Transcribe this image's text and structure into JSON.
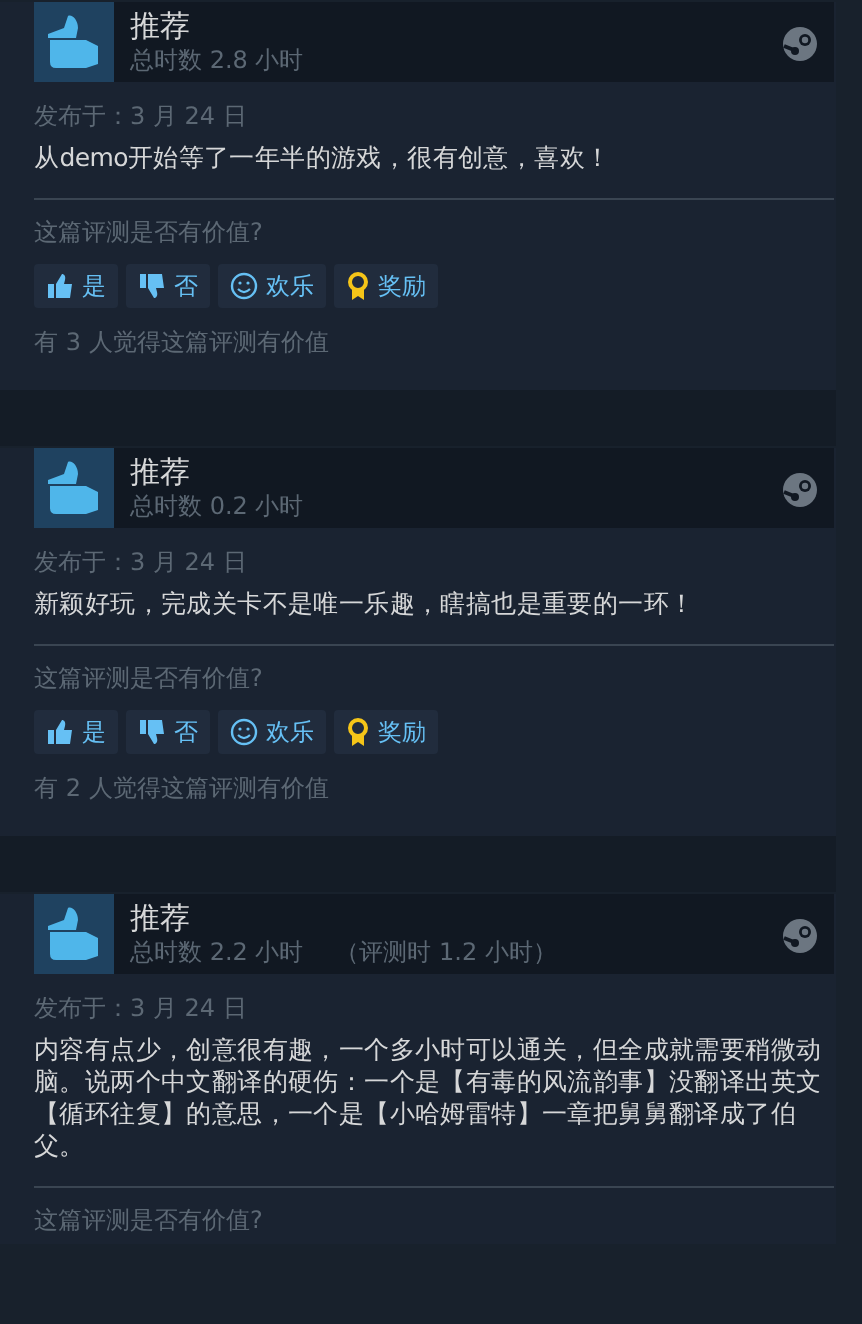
{
  "reviews": [
    {
      "verdict": "推荐",
      "hours": "总时数 2.8 小时",
      "date": "发布于：3 月 24 日",
      "text": "从demo开始等了一年半的游戏，很有创意，喜欢！",
      "question": "这篇评测是否有价值?",
      "buttons": [
        {
          "kind": "up",
          "label": "是"
        },
        {
          "kind": "down",
          "label": "否"
        },
        {
          "kind": "funny",
          "label": "欢乐"
        },
        {
          "kind": "award",
          "label": "奖励"
        }
      ],
      "helpful": "有 3 人觉得这篇评测有价值"
    },
    {
      "verdict": "推荐",
      "hours": "总时数 0.2 小时",
      "date": "发布于：3 月 24 日",
      "text": "新颖好玩，完成关卡不是唯一乐趣，瞎搞也是重要的一环！",
      "question": "这篇评测是否有价值?",
      "buttons": [
        {
          "kind": "up",
          "label": "是"
        },
        {
          "kind": "down",
          "label": "否"
        },
        {
          "kind": "funny",
          "label": "欢乐"
        },
        {
          "kind": "award",
          "label": "奖励"
        }
      ],
      "helpful": "有 2 人觉得这篇评测有价值"
    },
    {
      "verdict": "推荐",
      "hours": "总时数 2.2 小时",
      "review_hours": "（评测时 1.2 小时）",
      "date": "发布于：3 月 24 日",
      "text": "内容有点少，创意很有趣，一个多小时可以通关，但全成就需要稍微动脑。说两个中文翻译的硬伤：一个是【有毒的风流韵事】没翻译出英文【循环往复】的意思，一个是【小哈姆雷特】一章把舅舅翻译成了伯父。",
      "question": "这篇评测是否有价值?"
    }
  ]
}
